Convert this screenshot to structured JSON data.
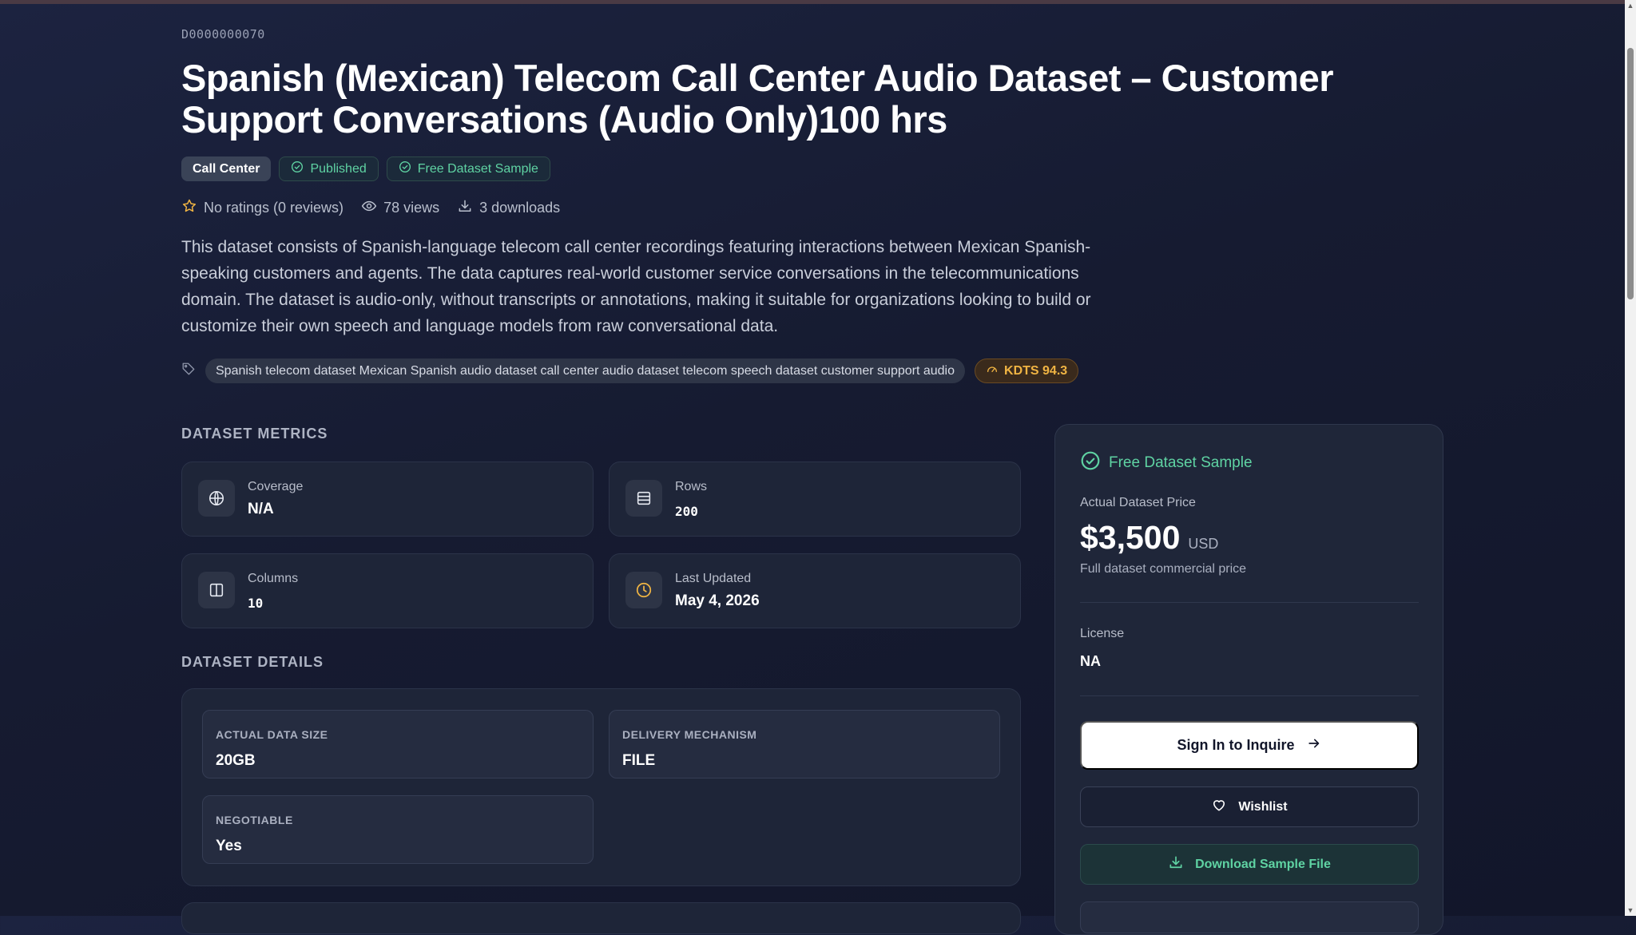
{
  "dataset": {
    "id": "D0000000070",
    "title": "Spanish (Mexican) Telecom Call Center Audio Dataset – Customer Support Conversations (Audio Only)100 hrs",
    "category": "Call Center",
    "status": "Published",
    "sample_badge": "Free Dataset Sample",
    "ratings": "No ratings (0 reviews)",
    "views": "78 views",
    "downloads": "3 downloads",
    "description": "This dataset consists of Spanish-language telecom call center recordings featuring interactions between Mexican Spanish-speaking customers and agents. The data captures real-world customer service conversations in the telecommunications domain. The dataset is audio-only, without transcripts or annotations, making it suitable for organizations looking to build or customize their own speech and language models from raw conversational data.",
    "tags": "Spanish telecom dataset Mexican Spanish audio dataset call center audio dataset telecom speech dataset customer support audio",
    "score": "KDTS 94.3"
  },
  "metrics": {
    "heading": "DATASET METRICS",
    "coverage_label": "Coverage",
    "coverage_value": "N/A",
    "rows_label": "Rows",
    "rows_value": "200",
    "columns_label": "Columns",
    "columns_value": "10",
    "updated_label": "Last Updated",
    "updated_value": "May 4, 2026"
  },
  "details": {
    "heading": "DATASET DETAILS",
    "size_label": "ACTUAL DATA SIZE",
    "size_value": "20GB",
    "delivery_label": "DELIVERY MECHANISM",
    "delivery_value": "FILE",
    "negotiable_label": "NEGOTIABLE",
    "negotiable_value": "Yes"
  },
  "sidebar": {
    "free_sample": "Free Dataset Sample",
    "price_label": "Actual Dataset Price",
    "price": "$3,500",
    "currency": "USD",
    "price_note": "Full dataset commercial price",
    "license_label": "License",
    "license_value": "NA",
    "inquire_button": "Sign In to Inquire",
    "wishlist_button": "Wishlist",
    "download_button": "Download Sample File"
  },
  "colors": {
    "accent_green": "#5fd3a3",
    "accent_amber": "#f0b443",
    "background": "#161b31"
  },
  "icons": [
    "check-circle-icon",
    "star-icon",
    "eye-icon",
    "download-icon",
    "tag-icon",
    "gauge-icon",
    "globe-icon",
    "rows-icon",
    "columns-icon",
    "clock-icon",
    "arrow-right-icon",
    "heart-icon"
  ]
}
